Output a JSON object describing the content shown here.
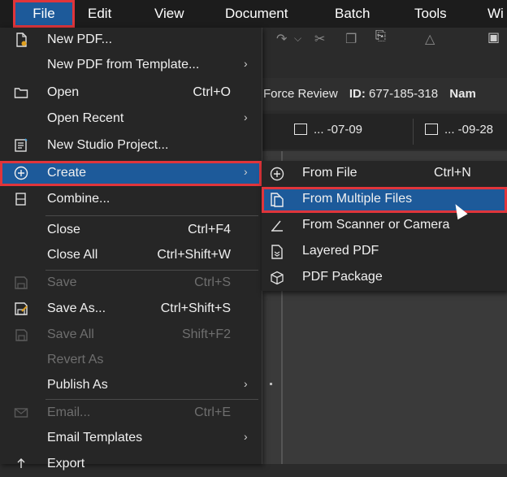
{
  "menubar": {
    "items": [
      "File",
      "Edit",
      "View",
      "Document",
      "Batch",
      "Tools",
      "Wi"
    ]
  },
  "infobar": {
    "prefix": "Force Review",
    "id_label": "ID:",
    "id_value": "677-185-318",
    "name_label": "Nam"
  },
  "tabs": [
    {
      "label": "... -07-09"
    },
    {
      "label": "... -09-28"
    }
  ],
  "file_menu": {
    "items": [
      {
        "label": "New PDF...",
        "shortcut": "",
        "icon": "new-pdf-icon",
        "submenu": false,
        "disabled": false
      },
      {
        "label": "New PDF from Template...",
        "shortcut": "",
        "icon": "",
        "submenu": true,
        "disabled": false
      },
      {
        "label": "Open",
        "shortcut": "Ctrl+O",
        "icon": "folder-icon",
        "submenu": false,
        "disabled": false
      },
      {
        "label": "Open Recent",
        "shortcut": "",
        "icon": "",
        "submenu": true,
        "disabled": false
      },
      {
        "label": "New Studio Project...",
        "shortcut": "",
        "icon": "studio-project-icon",
        "submenu": false,
        "disabled": false
      },
      {
        "label": "Create",
        "shortcut": "",
        "icon": "plus-circle-icon",
        "submenu": true,
        "disabled": false,
        "highlighted": true
      },
      {
        "label": "Combine...",
        "shortcut": "",
        "icon": "combine-icon",
        "submenu": false,
        "disabled": false
      },
      {
        "label": "Close",
        "shortcut": "Ctrl+F4",
        "icon": "",
        "submenu": false,
        "disabled": false
      },
      {
        "label": "Close All",
        "shortcut": "Ctrl+Shift+W",
        "icon": "",
        "submenu": false,
        "disabled": false
      },
      {
        "label": "Save",
        "shortcut": "Ctrl+S",
        "icon": "save-icon",
        "submenu": false,
        "disabled": true
      },
      {
        "label": "Save As...",
        "shortcut": "Ctrl+Shift+S",
        "icon": "save-as-icon",
        "submenu": false,
        "disabled": false
      },
      {
        "label": "Save All",
        "shortcut": "Shift+F2",
        "icon": "save-all-icon",
        "submenu": false,
        "disabled": true
      },
      {
        "label": "Revert As",
        "shortcut": "",
        "icon": "",
        "submenu": false,
        "disabled": true
      },
      {
        "label": "Publish As",
        "shortcut": "",
        "icon": "",
        "submenu": true,
        "disabled": false
      },
      {
        "label": "Email...",
        "shortcut": "Ctrl+E",
        "icon": "email-icon",
        "submenu": false,
        "disabled": true
      },
      {
        "label": "Email Templates",
        "shortcut": "",
        "icon": "",
        "submenu": true,
        "disabled": false
      },
      {
        "label": "Export",
        "shortcut": "",
        "icon": "export-icon",
        "submenu": false,
        "disabled": false
      }
    ]
  },
  "create_submenu": {
    "items": [
      {
        "label": "From File",
        "shortcut": "Ctrl+N",
        "icon": "plus-circle-icon"
      },
      {
        "label": "From Multiple Files",
        "shortcut": "",
        "icon": "multiple-files-icon",
        "highlighted": true
      },
      {
        "label": "From Scanner or Camera",
        "shortcut": "",
        "icon": "scanner-icon"
      },
      {
        "label": "Layered PDF",
        "shortcut": "",
        "icon": "layers-icon"
      },
      {
        "label": "PDF Package",
        "shortcut": "",
        "icon": "package-icon"
      }
    ]
  },
  "colors": {
    "highlight": "#1d5a9a",
    "callout": "#e0353b",
    "menu_bg": "#262626",
    "menubar_bg": "#1c1c1c"
  }
}
